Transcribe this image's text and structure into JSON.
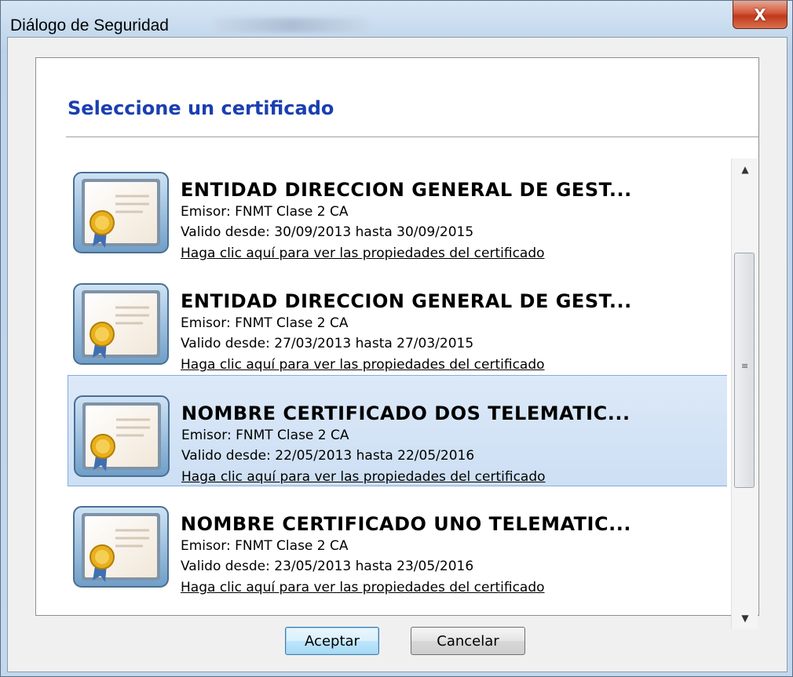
{
  "window": {
    "title": "Diálogo de Seguridad",
    "close_label": "X"
  },
  "dialog": {
    "heading": "Seleccione un certificado",
    "heading_color": "#1a3fb0",
    "selection_color": "#cddff4"
  },
  "certificates": [
    {
      "title": "ENTIDAD DIRECCION GENERAL DE GEST...",
      "issuer": "Emisor: FNMT Clase 2 CA",
      "validity": "Valido desde: 30/09/2013 hasta 30/09/2015",
      "link": "Haga clic aquí para ver las propiedades del certificado",
      "icon": "certificate-icon",
      "selected": false
    },
    {
      "title": "ENTIDAD DIRECCION GENERAL DE GEST...",
      "issuer": "Emisor: FNMT Clase 2 CA",
      "validity": "Valido desde: 27/03/2013 hasta 27/03/2015",
      "link": "Haga clic aquí para ver las propiedades del certificado",
      "icon": "certificate-icon",
      "selected": false
    },
    {
      "title": "NOMBRE CERTIFICADO DOS TELEMATIC...",
      "issuer": "Emisor: FNMT Clase 2 CA",
      "validity": "Valido desde: 22/05/2013 hasta 22/05/2016",
      "link": "Haga clic aquí para ver las propiedades del certificado",
      "icon": "certificate-icon",
      "selected": true
    },
    {
      "title": "NOMBRE CERTIFICADO UNO TELEMATIC...",
      "issuer": "Emisor: FNMT Clase 2 CA",
      "validity": "Valido desde: 23/05/2013 hasta 23/05/2016",
      "link": "Haga clic aquí para ver las propiedades del certificado",
      "icon": "certificate-icon",
      "selected": false
    }
  ],
  "scrollbar": {
    "up_icon": "scroll-up-arrow-icon",
    "down_icon": "scroll-down-arrow-icon",
    "grip_icon": "scroll-grip-icon"
  },
  "buttons": {
    "accept_label": "Aceptar",
    "cancel_label": "Cancelar"
  }
}
